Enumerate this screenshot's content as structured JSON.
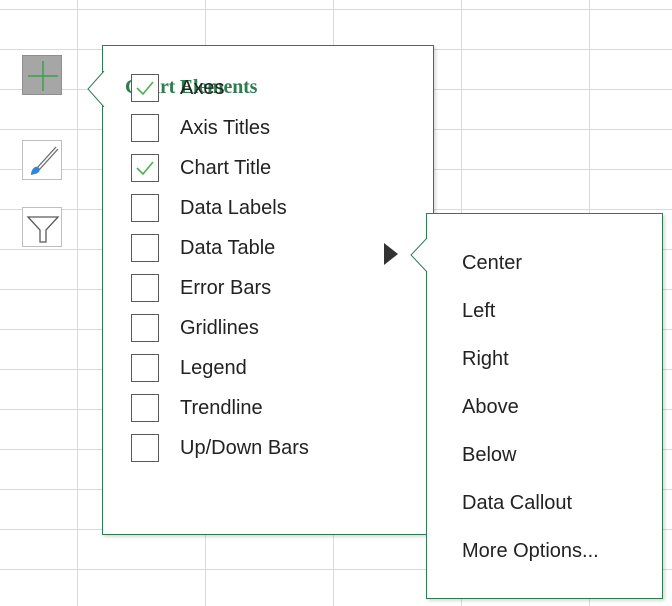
{
  "chart_buttons": [
    {
      "name": "chart-elements",
      "icon": "plus-icon",
      "active": true
    },
    {
      "name": "chart-styles",
      "icon": "paintbrush-icon",
      "active": false
    },
    {
      "name": "chart-filters",
      "icon": "funnel-icon",
      "active": false
    }
  ],
  "chart_elements": {
    "title": "Chart Elements",
    "items": [
      {
        "label": "Axes",
        "checked": true
      },
      {
        "label": "Axis Titles",
        "checked": false
      },
      {
        "label": "Chart Title",
        "checked": true
      },
      {
        "label": "Data Labels",
        "checked": false,
        "has_submenu": true
      },
      {
        "label": "Data Table",
        "checked": false
      },
      {
        "label": "Error Bars",
        "checked": false
      },
      {
        "label": "Gridlines",
        "checked": false
      },
      {
        "label": "Legend",
        "checked": false
      },
      {
        "label": "Trendline",
        "checked": false
      },
      {
        "label": "Up/Down Bars",
        "checked": false
      }
    ]
  },
  "data_labels_submenu": {
    "items": [
      {
        "label": "Center"
      },
      {
        "label": "Left"
      },
      {
        "label": "Right"
      },
      {
        "label": "Above"
      },
      {
        "label": "Below"
      },
      {
        "label": "Data Callout"
      },
      {
        "label": "More Options..."
      }
    ]
  },
  "colors": {
    "accent_green": "#2e7d4f",
    "check_green": "#4caf50",
    "active_button_gray": "#a6a6a6",
    "icon_blue": "#2e86de",
    "grid_line": "#d9d9d9"
  }
}
